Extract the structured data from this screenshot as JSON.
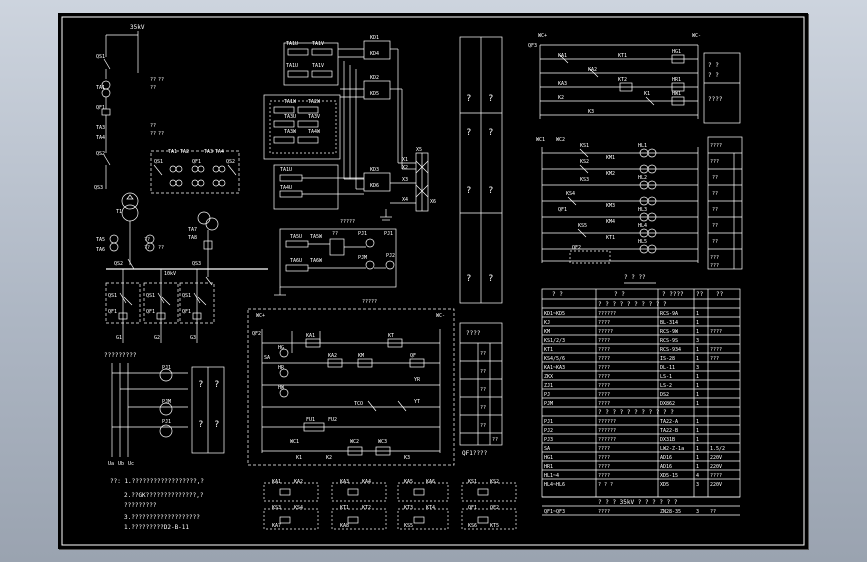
{
  "colors": {
    "background": "#000000",
    "line": "#ffffff",
    "frame": "#b9c2ce"
  },
  "left": {
    "voltage_35": "35kV",
    "voltage_10": "10kV",
    "labels": [
      "QS1",
      "TA1",
      "QF1",
      "TA3",
      "TA4",
      "QS2",
      "QS1",
      "TA1",
      "TA2",
      "TA3",
      "TA4",
      "QF1",
      "QS2",
      "QS3",
      "T1",
      "TA5",
      "TA6",
      "TA7",
      "TA8",
      "QS2",
      "QS3",
      "QS1",
      "QF1",
      "QS1",
      "QF1",
      "QS1",
      "QF1",
      "G1",
      "G2",
      "G3"
    ],
    "unknown": [
      "??",
      "??",
      "??",
      "??",
      "??",
      "??",
      "??",
      "??",
      "??"
    ],
    "meter_title": "?????????",
    "meter_labels": [
      "PJ1",
      "PJM",
      "PJ1"
    ],
    "box_glyphs": [
      "?",
      "?",
      "?",
      "?"
    ],
    "bus_labels": [
      "Ua",
      "Ub",
      "Uc"
    ],
    "notes": [
      "??:  1.??????????????????,?",
      "2.??GK??????????????,?",
      "?????????",
      "3.???????????????????",
      "1.?????????D2-B-11"
    ]
  },
  "center": {
    "ct_labels": [
      "TA1U",
      "TA1V",
      "TA1U",
      "TA1V",
      "TA1W",
      "TA2W",
      "TA3U",
      "TA3V",
      "TA3W",
      "TA4W",
      "TA1U",
      "TA4U",
      "TA5U",
      "TA5W",
      "TA6U",
      "TA6W"
    ],
    "relay_labels": [
      "KD1",
      "KD2",
      "KD3",
      "KD4",
      "KD5",
      "KD6"
    ],
    "terminal_labels": [
      "X1",
      "X2",
      "X3",
      "X4",
      "X5",
      "X6"
    ],
    "unknown": [
      "??",
      "?????",
      "?????",
      "PJ1",
      "PJM",
      "PJ2",
      "PJ1"
    ],
    "control_labels": [
      "WC+",
      "WC-",
      "QF2",
      "HG",
      "HR",
      "HW",
      "SA",
      "KA1",
      "KA2",
      "KM",
      "KT",
      "QF",
      "YR",
      "YT",
      "TCO",
      "FU1",
      "FU2",
      "WC1",
      "WC2",
      "WC3",
      "K1",
      "K2",
      "K3"
    ],
    "bottom_labels": [
      "KA1",
      "KA2",
      "KA3",
      "KA4",
      "KA5",
      "KA6",
      "KS1",
      "KS2",
      "KS3",
      "KS4",
      "KT1",
      "KT2",
      "KT3",
      "KT4",
      "QF1",
      "QF2",
      "KA7",
      "KA8",
      "KS5",
      "KS6",
      "KT5"
    ]
  },
  "legend_panel": {
    "glyphs": [
      "?",
      "?",
      "?",
      "?",
      "?",
      "?",
      "?",
      "?"
    ],
    "caption": "????",
    "rows": [
      "??",
      "??",
      "??",
      "??",
      "??",
      "??"
    ],
    "footer": "QF1????"
  },
  "right": {
    "top_labels": [
      "WC+",
      "WC-",
      "QF3",
      "KA1",
      "KA2",
      "KT1",
      "KA3",
      "KT2",
      "K1",
      "K2",
      "K3",
      "HG1",
      "HR1",
      "HW1"
    ],
    "top_notes": [
      "? ?",
      "? ?",
      "????"
    ],
    "mid_labels": [
      "WC1",
      "WC2",
      "KS1",
      "KS2",
      "KS3",
      "KS4",
      "KS5",
      "KM1",
      "KM2",
      "KM3",
      "KM4",
      "KT1",
      "QF1",
      "QF2",
      "HL1",
      "HL2",
      "HL3",
      "HL4",
      "HL5"
    ],
    "mid_notes": [
      "????",
      "???",
      "??",
      "??",
      "??",
      "??",
      "??",
      "???",
      "???"
    ],
    "table_title": "? ? ??",
    "table_header": [
      "? ?",
      "? ?",
      "? ????",
      "??",
      "??"
    ],
    "section1": "? ? ? ? ? ? ? ? ? ?",
    "rows1": [
      [
        "KD1~KD5",
        "??????",
        "RCS-9A",
        "1",
        ""
      ],
      [
        "KJ",
        "????",
        "BL-314",
        "1",
        ""
      ],
      [
        "KM",
        "?????",
        "RCS-9W",
        "1",
        "????"
      ],
      [
        "KS1/2/3",
        "????",
        "RCS-9S",
        "3",
        ""
      ],
      [
        "KT1",
        "????",
        "RCS-934",
        "1",
        "????"
      ],
      [
        "KS4/5/6",
        "????",
        "IS-28",
        "1",
        "???"
      ],
      [
        "KA1~KA3",
        "????",
        "DL-11",
        "3",
        ""
      ],
      [
        "ZKX",
        "????",
        "LS-1",
        "1",
        ""
      ],
      [
        "ZJ1",
        "????",
        "LS-2",
        "1",
        ""
      ],
      [
        "PJ",
        "????",
        "DS2",
        "1",
        ""
      ],
      [
        "PJM",
        "????",
        "DX862",
        "1",
        ""
      ]
    ],
    "section2": "? ? ? ? ? ? ? ? ? ? ?",
    "rows2": [
      [
        "PJ1",
        "??????",
        "TA22-A",
        "1",
        ""
      ],
      [
        "PJ2",
        "??????",
        "TA22-B",
        "1",
        ""
      ],
      [
        "PJ3",
        "??????",
        "DX31B",
        "1",
        ""
      ],
      [
        "SA",
        "????",
        "LW2-Z-1a",
        "1",
        "1.5/2"
      ],
      [
        "HG1",
        "????",
        "AD16",
        "1",
        "220V"
      ],
      [
        "HR1",
        "????",
        "AD16",
        "1",
        "220V"
      ],
      [
        "HL1~4",
        "????",
        "XD5-15",
        "4",
        "????"
      ],
      [
        "HL4~HL6",
        "? ? ?",
        "XD5",
        "3",
        "220V"
      ]
    ],
    "section3": "? ? ? 35kV ? ? ? ? ? ?",
    "rows3": [
      [
        "QF1~QF3",
        "????",
        "ZN28-35",
        "3",
        "??"
      ]
    ]
  }
}
